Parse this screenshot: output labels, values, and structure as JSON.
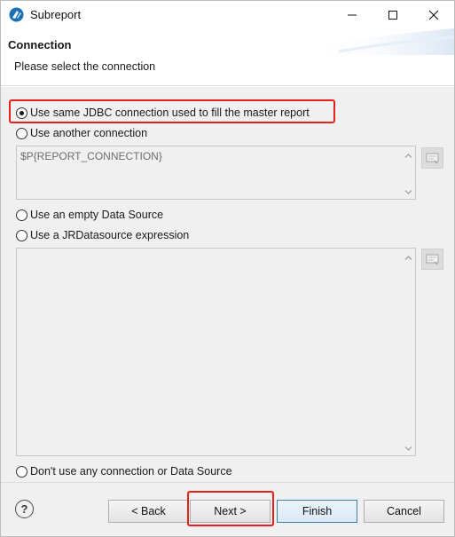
{
  "window": {
    "title": "Subreport"
  },
  "header": {
    "title": "Connection",
    "subtitle": "Please select the connection"
  },
  "options": {
    "same_jdbc": {
      "label": "Use same JDBC connection used to fill the master report",
      "checked": true
    },
    "another_connection": {
      "label": "Use another connection",
      "checked": false
    },
    "connection_expression": "$P{REPORT_CONNECTION}",
    "empty_data_source": {
      "label": "Use an empty Data Source",
      "checked": false
    },
    "jrdatasource": {
      "label": "Use a JRDatasource expression",
      "checked": false
    },
    "datasource_expression": "",
    "no_connection": {
      "label": "Don't use any connection or Data Source",
      "checked": false
    }
  },
  "footer": {
    "help": "?",
    "back": "< Back",
    "next": "Next >",
    "finish": "Finish",
    "cancel": "Cancel"
  },
  "colors": {
    "highlight": "#e8201a",
    "primary_border": "#3c7fb1"
  }
}
